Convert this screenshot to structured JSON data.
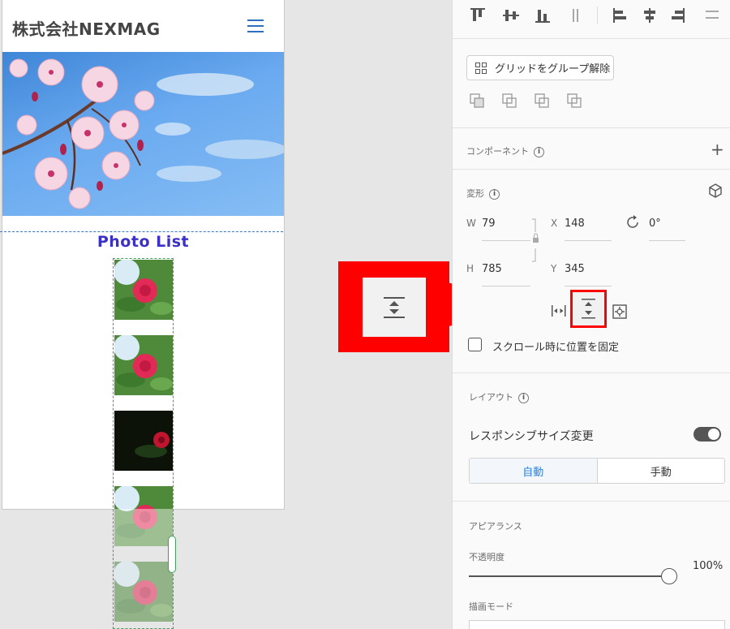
{
  "artboard": {
    "company_name": "株式会社NEXMAG",
    "photo_list_title": "Photo List",
    "hero_image": "cherry-blossom-photo",
    "thumbnails": [
      "red-camellia",
      "red-camellia",
      "red-rose-dark",
      "red-camellia",
      "red-camellia"
    ]
  },
  "panel": {
    "ungroup_grid_button": "グリッドをグループ解除",
    "component_heading": "コンポーネント",
    "transform_heading": "変形",
    "width_label": "W",
    "width_value": "79",
    "x_label": "X",
    "x_value": "148",
    "rotation_value": "0°",
    "height_label": "H",
    "height_value": "785",
    "y_label": "Y",
    "y_value": "345",
    "fix_position_label": "スクロール時に位置を固定",
    "layout_heading": "レイアウト",
    "responsive_resize_label": "レスポンシブサイズ変更",
    "responsive_enabled": true,
    "mode_auto": "自動",
    "mode_manual": "手動",
    "appearance_heading": "アピアランス",
    "opacity_label": "不透明度",
    "opacity_value": "100%",
    "opacity_level": 1.0,
    "blend_mode_label": "描画モード"
  },
  "colors": {
    "callout_red": "#ff0000",
    "accent_blue": "#2a7fd4",
    "title_purple": "#3b30c8",
    "selection_green": "#3ca05a"
  }
}
